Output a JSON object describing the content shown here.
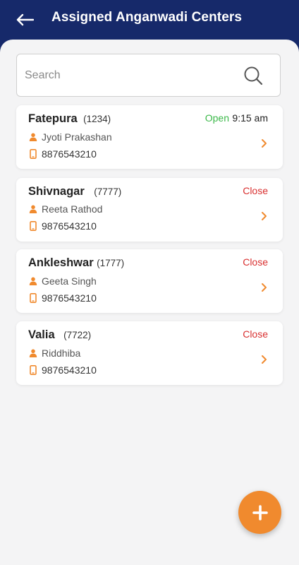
{
  "header": {
    "title": "Assigned Anganwadi Centers",
    "back_icon": "arrow-left-icon"
  },
  "search": {
    "placeholder": "Search",
    "value": "",
    "icon": "search-icon"
  },
  "centers": [
    {
      "name": "Fatepura",
      "code": "(1234)",
      "status": "Open",
      "time": "9:15 am",
      "worker": "Jyoti Prakashan",
      "phone": "8876543210"
    },
    {
      "name": "Shivnagar",
      "code": "(7777)",
      "status": "Close",
      "time": "",
      "worker": "Reeta Rathod",
      "phone": "9876543210"
    },
    {
      "name": "Ankleshwar",
      "code": "(1777)",
      "status": "Close",
      "time": "",
      "worker": "Geeta Singh",
      "phone": "9876543210"
    },
    {
      "name": "Valia",
      "code": "(7722)",
      "status": "Close",
      "time": "",
      "worker": "Riddhiba",
      "phone": "9876543210"
    }
  ],
  "fab": {
    "label": "+",
    "icon": "plus-icon"
  },
  "colors": {
    "header_bg": "#16296a",
    "accent": "#f08a2e",
    "open": "#3cb94a",
    "close": "#d93030",
    "content_bg": "#f4f4f5"
  }
}
